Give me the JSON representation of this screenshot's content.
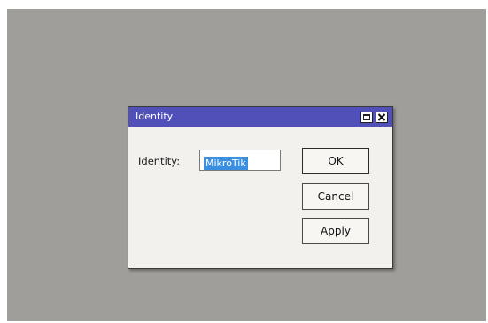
{
  "dialog": {
    "title": "Identity",
    "field_label": "Identity:",
    "field_value": "MikroTik",
    "buttons": {
      "ok": "OK",
      "cancel": "Cancel",
      "apply": "Apply"
    },
    "title_icons": [
      "maximize-icon",
      "close-icon"
    ]
  },
  "colors": {
    "titlebar": "#5050b8",
    "workspace": "#a09e9b",
    "selection": "#3b8fe0"
  }
}
